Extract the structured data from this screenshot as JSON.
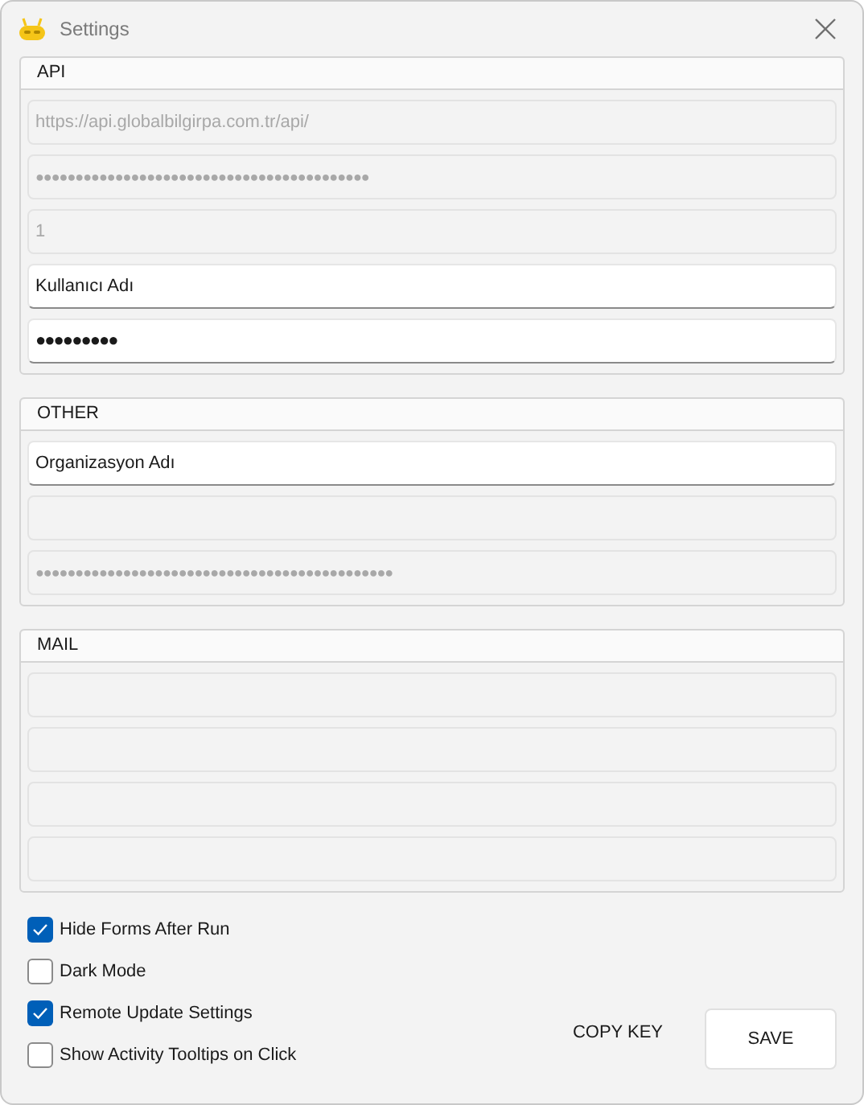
{
  "window": {
    "title": "Settings"
  },
  "groups": [
    {
      "title": "API",
      "fields": [
        {
          "value": "https://api.globalbilgirpa.com.tr/api/",
          "disabled": true,
          "kind": "text"
        },
        {
          "value": "●●●●●●●●●●●●●●●●●●●●●●●●●●●●●●●●●●●●●●●●●●",
          "disabled": true,
          "kind": "masked"
        },
        {
          "value": "1",
          "disabled": true,
          "kind": "text"
        },
        {
          "value": "Kullanıcı Adı",
          "disabled": false,
          "kind": "text"
        },
        {
          "value": "●●●●●●●●●",
          "disabled": false,
          "kind": "masked"
        }
      ]
    },
    {
      "title": "OTHER",
      "fields": [
        {
          "value": "Organizasyon Adı",
          "disabled": false,
          "kind": "text"
        },
        {
          "disabled": true,
          "kind": "text"
        },
        {
          "value": "●●●●●●●●●●●●●●●●●●●●●●●●●●●●●●●●●●●●●●●●●●●●●",
          "disabled": true,
          "kind": "masked"
        }
      ]
    },
    {
      "title": "MAIL",
      "fields": [
        {
          "disabled": true,
          "kind": "text"
        },
        {
          "disabled": true,
          "kind": "text"
        },
        {
          "disabled": true,
          "kind": "text"
        },
        {
          "disabled": true,
          "kind": "text"
        }
      ]
    }
  ],
  "options": [
    {
      "label": "Hide Forms After Run",
      "checked": true
    },
    {
      "label": "Dark Mode",
      "checked": false
    },
    {
      "label": "Remote Update Settings",
      "checked": true
    },
    {
      "label": "Show Activity Tooltips on Click",
      "checked": false
    }
  ],
  "buttons": [
    {
      "label": "COPY KEY",
      "kind": "flat"
    },
    {
      "label": "SAVE",
      "kind": "raised"
    }
  ]
}
